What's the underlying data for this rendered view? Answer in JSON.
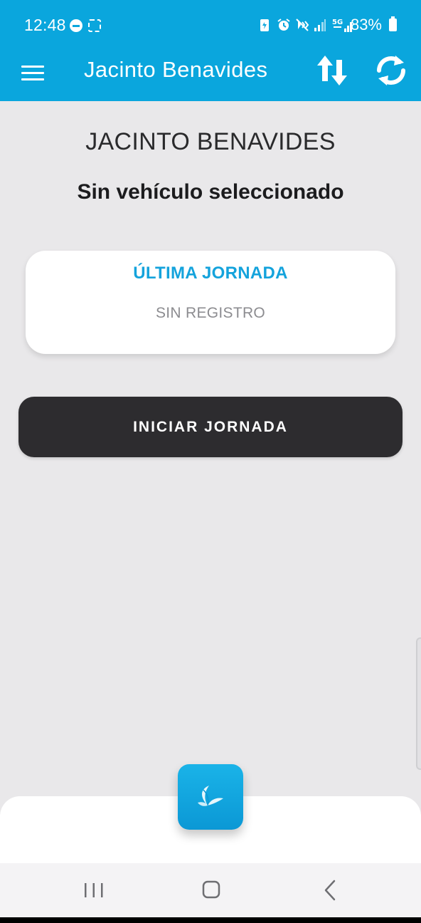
{
  "status_bar": {
    "time": "12:48",
    "battery": "83%",
    "icons": [
      "do-not-disturb-icon",
      "screen-capture-icon",
      "battery-saver-icon",
      "alarm-icon",
      "vibrate-icon",
      "signal-icon",
      "5g-signal-icon",
      "battery-icon"
    ]
  },
  "app_bar": {
    "title": "Jacinto Benavides",
    "menu_icon": "hamburger-menu-icon",
    "sync_icon": "sync-arrows-icon",
    "refresh_icon": "refresh-icon"
  },
  "main": {
    "driver_name": "JACINTO BENAVIDES",
    "vehicle_status": "Sin vehículo seleccionado",
    "last_shift_card": {
      "title": "ÚLTIMA JORNADA",
      "value": "SIN REGISTRO"
    },
    "start_button_label": "INICIAR JORNADA"
  },
  "fab": {
    "icon": "app-logo-icon"
  },
  "nav_bar": {
    "recent_icon": "recent-apps-icon",
    "home_icon": "home-icon",
    "back_icon": "back-icon"
  },
  "colors": {
    "primary": "#0aa6dd",
    "background": "#e9e8ea",
    "button_dark": "#2d2c2f",
    "card_title": "#14a3dc"
  }
}
